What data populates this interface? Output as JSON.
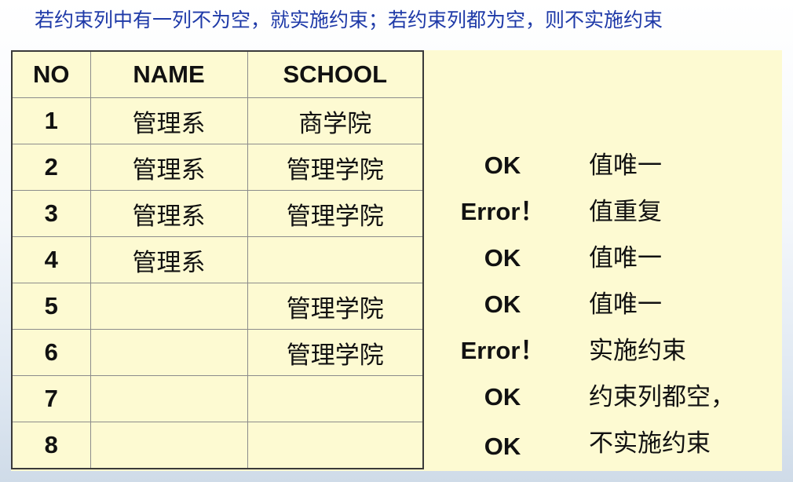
{
  "heading": "若约束列中有一列不为空，就实施约束；若约束列都为空，则不实施约束",
  "table": {
    "headers": [
      "NO",
      "NAME",
      "SCHOOL"
    ],
    "rows": [
      {
        "no": "1",
        "name": "管理系",
        "school": "商学院"
      },
      {
        "no": "2",
        "name": "管理系",
        "school": "管理学院"
      },
      {
        "no": "3",
        "name": "管理系",
        "school": "管理学院"
      },
      {
        "no": "4",
        "name": "管理系",
        "school": ""
      },
      {
        "no": "5",
        "name": "",
        "school": "管理学院"
      },
      {
        "no": "6",
        "name": "",
        "school": "管理学院"
      },
      {
        "no": "7",
        "name": "",
        "school": ""
      },
      {
        "no": "8",
        "name": "",
        "school": ""
      }
    ]
  },
  "annotations": [
    {
      "status": "OK",
      "note": "值唯一"
    },
    {
      "status": "Error！",
      "note": "值重复"
    },
    {
      "status": "OK",
      "note": "值唯一"
    },
    {
      "status": "OK",
      "note": "值唯一"
    },
    {
      "status": "Error！",
      "note": "实施约束"
    },
    {
      "status": "OK",
      "note": "约束列都空，"
    },
    {
      "status": "OK",
      "note": "不实施约束"
    }
  ]
}
